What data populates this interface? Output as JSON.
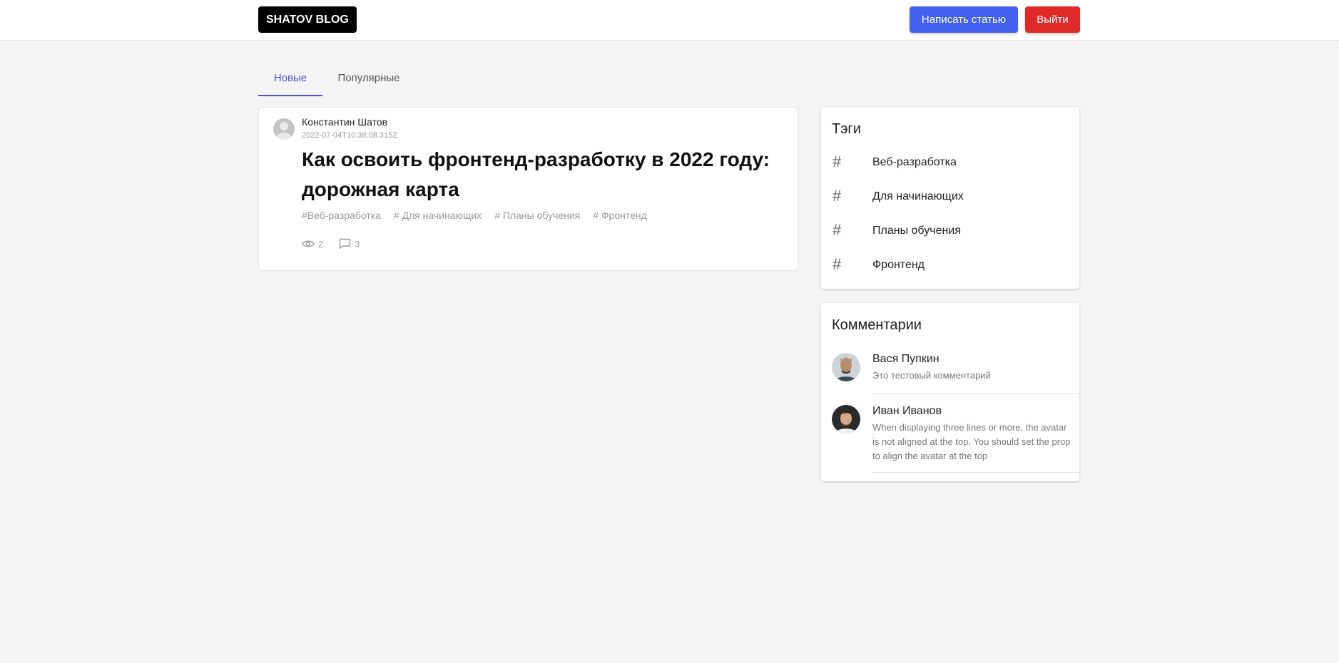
{
  "header": {
    "logo": "SHATOV BLOG",
    "write_button": "Написать статью",
    "logout_button": "Выйти"
  },
  "tabs": [
    {
      "label": "Новые",
      "active": true
    },
    {
      "label": "Популярные",
      "active": false
    }
  ],
  "post": {
    "author": "Константин Шатов",
    "date": "2022-07-04T10:38:08.315Z",
    "title": "Как освоить фронтенд-разработку в 2022 году: дорожная карта",
    "tags": [
      "#Веб-разработка",
      "# Для начинающих",
      "# Планы обучения",
      "# Фронтенд"
    ],
    "views": "2",
    "comments": "3"
  },
  "tags_block": {
    "title": "Тэги",
    "items": [
      "Веб-разработка",
      "Для начинающих",
      "Планы обучения",
      "Фронтенд"
    ]
  },
  "comments_block": {
    "title": "Комментарии",
    "items": [
      {
        "name": "Вася Пупкин",
        "text": "Это тестовый комментарий"
      },
      {
        "name": "Иван Иванов",
        "text": "When displaying three lines or more, the avatar is not aligned at the top. You should set the prop to align the avatar at the top"
      }
    ]
  },
  "colors": {
    "accent": "#4361ee",
    "danger": "#e02a2a",
    "tab_active": "#4a55cf",
    "background": "#f4f4f4"
  }
}
